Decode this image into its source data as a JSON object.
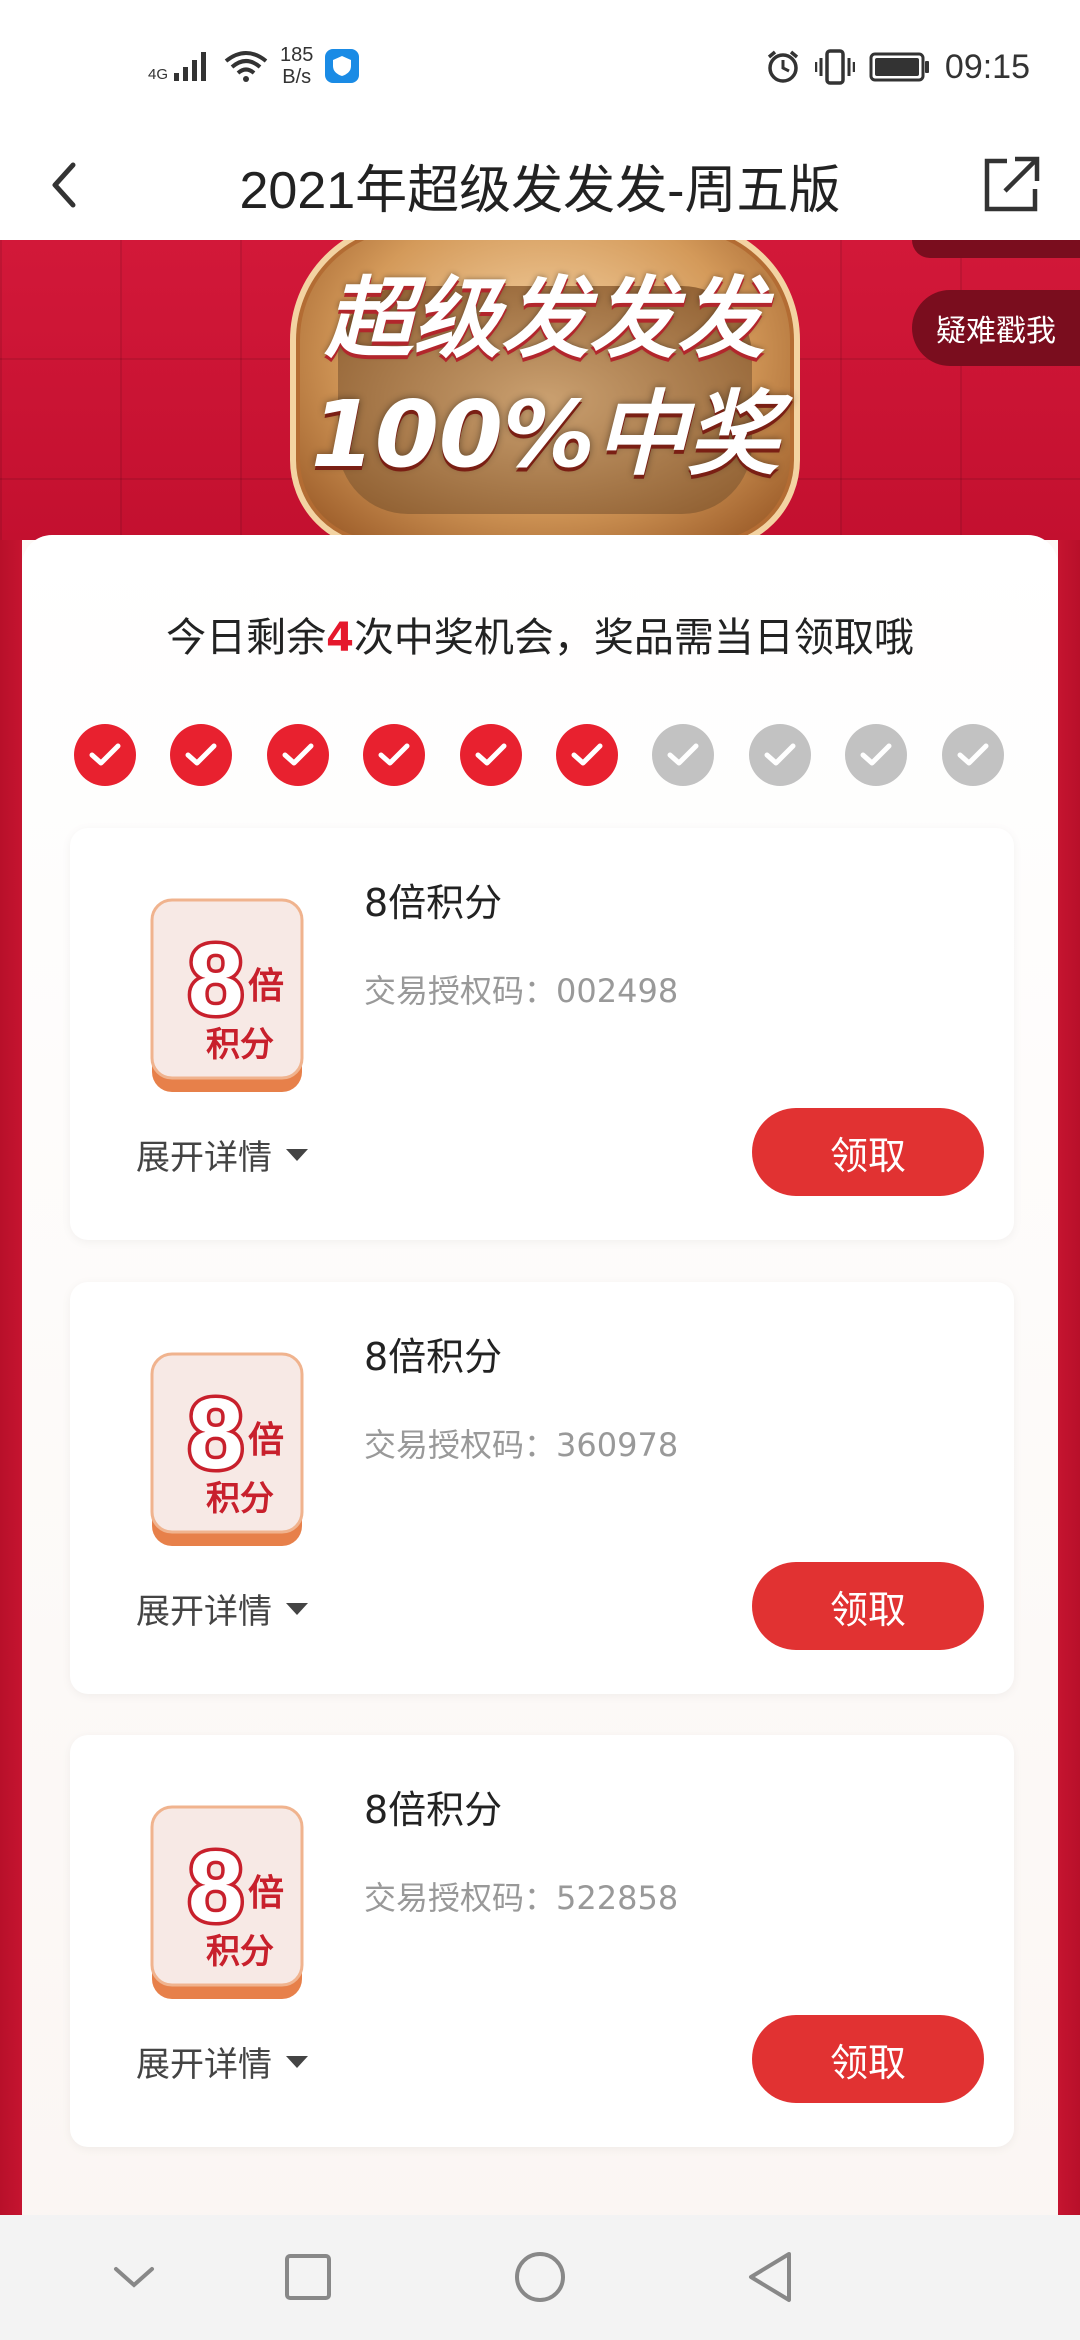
{
  "status_bar": {
    "network_label": "4G",
    "speed_value": "185",
    "speed_unit": "B/s",
    "time": "09:15"
  },
  "header": {
    "title": "2021年超级发发发-周五版"
  },
  "banner": {
    "line1": "超级发发发",
    "line2": "100%中奖",
    "help_button": "疑难戳我"
  },
  "chances": {
    "prefix": "今日剩余",
    "count": "4",
    "suffix": "次中奖机会，奖品需当日领取哦",
    "total_slots": 10,
    "used_slots": 6
  },
  "prizes": [
    {
      "title": "8倍积分",
      "code_label": "交易授权码：",
      "code": "002498",
      "image_big": "8",
      "image_small": "倍",
      "image_sub": "积分",
      "expand_label": "展开详情",
      "claim_label": "领取"
    },
    {
      "title": "8倍积分",
      "code_label": "交易授权码：",
      "code": "360978",
      "image_big": "8",
      "image_small": "倍",
      "image_sub": "积分",
      "expand_label": "展开详情",
      "claim_label": "领取"
    },
    {
      "title": "8倍积分",
      "code_label": "交易授权码：",
      "code": "522858",
      "image_big": "8",
      "image_small": "倍",
      "image_sub": "积分",
      "expand_label": "展开详情",
      "claim_label": "领取"
    }
  ],
  "colors": {
    "accent": "#e13232",
    "dot_on": "#e8212f",
    "dot_off": "#c2c2c2",
    "banner": "#c3102f"
  }
}
